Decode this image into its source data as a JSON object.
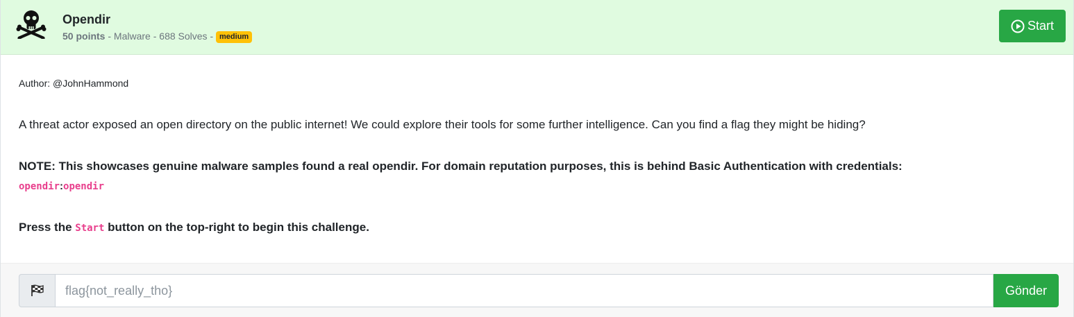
{
  "challenge": {
    "title": "Opendir",
    "points": "50 points",
    "sep1": " - ",
    "category": "Malware",
    "sep2": " - ",
    "solves": "688 Solves",
    "sep3": " - ",
    "difficulty": "medium"
  },
  "header": {
    "start_label": "Start",
    "icon": "skull-crossbones-icon",
    "accent": "#28a745",
    "background": "#e0fbe0"
  },
  "description": {
    "author": "Author: @JohnHammond",
    "text": "A threat actor exposed an open directory on the public internet! We could explore their tools for some further intelligence. Can you find a flag they might be hiding?",
    "note": "NOTE: This showcases genuine malware samples found a real opendir. For domain reputation purposes, this is behind Basic Authentication with credentials:",
    "cred_user": "opendir",
    "cred_sep": ":",
    "cred_pass": "opendir",
    "press_prefix": "Press the ",
    "press_code": "Start",
    "press_suffix": " button on the top-right to begin this challenge."
  },
  "submission": {
    "placeholder": "flag{not_really_tho}",
    "value": "",
    "submit_label": "Gönder",
    "icon": "checkered-flag-icon"
  }
}
